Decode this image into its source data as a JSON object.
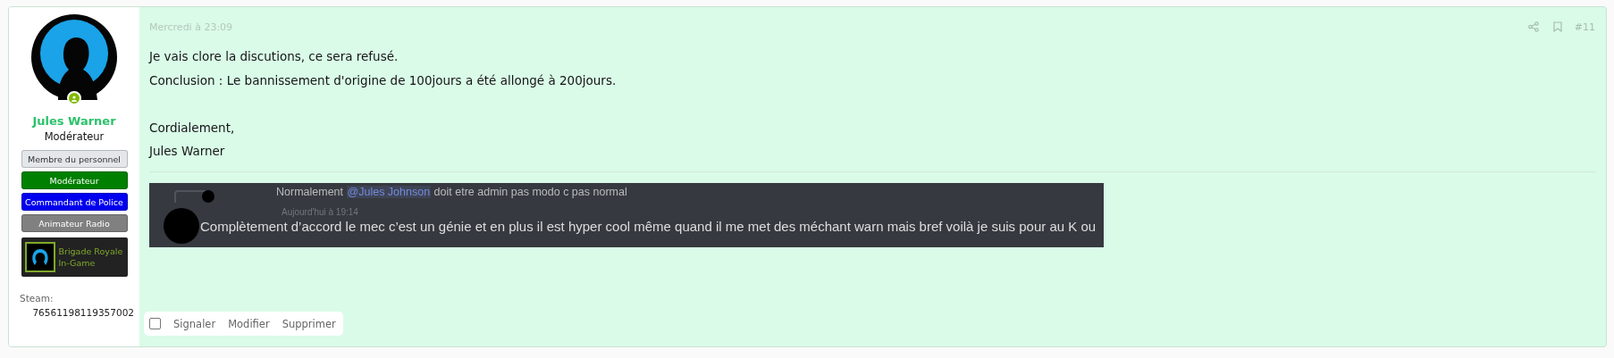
{
  "author": {
    "name": "Jules Warner",
    "title": "Modérateur",
    "online": true,
    "banners": [
      {
        "label": "Membre du personnel",
        "color": "#e4e7ea"
      },
      {
        "label": "Modérateur",
        "color": "#008000"
      },
      {
        "label": "Commandant de Police",
        "color": "#0000ee"
      },
      {
        "label": "Animateur Radio",
        "color": "#808080"
      }
    ],
    "group": {
      "name": "Brigade Royale",
      "status": "In-Game"
    },
    "steam_label": "Steam:",
    "steam_id": "76561198119357002"
  },
  "post": {
    "date": "Mercredi à 23:09",
    "number": "#11",
    "paragraphs": [
      [
        "Je vais clore la discutions, ce sera refusé.",
        "Conclusion : Le bannissement d'origine de 100jours a été allongé à 200jours."
      ],
      [
        "Cordialement,",
        "Jules Warner"
      ]
    ],
    "embed": {
      "reply_before": "Normalement",
      "mention": "@Jules Johnson",
      "reply_after": "doit etre admin pas modo c pas normal",
      "time": "Aujourd'hui à 19:14",
      "message": "Complètement d’accord le mec c’est un génie et en plus il est hyper cool même quand il me met des méchant warn mais bref voilà je suis pour au K ou"
    },
    "select": {
      "checked": false
    },
    "actions": [
      "Signaler",
      "Modifier",
      "Supprimer"
    ]
  }
}
